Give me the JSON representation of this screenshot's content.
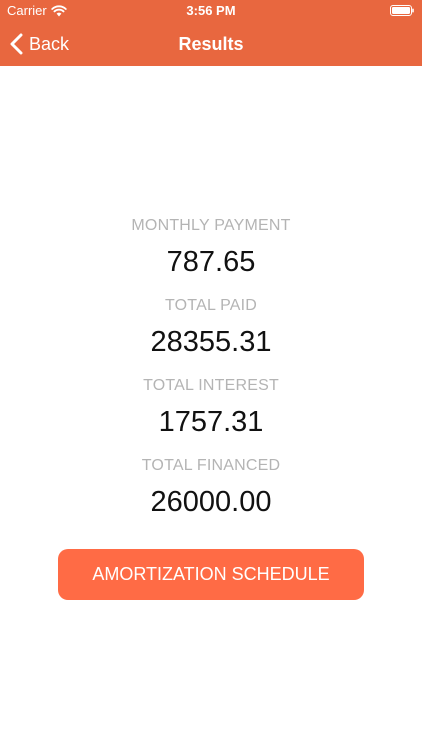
{
  "status_bar": {
    "carrier": "Carrier",
    "time": "3:56 PM"
  },
  "nav": {
    "back_label": "Back",
    "title": "Results"
  },
  "results": [
    {
      "label": "MONTHLY PAYMENT",
      "value": "787.65"
    },
    {
      "label": "TOTAL PAID",
      "value": "28355.31"
    },
    {
      "label": "TOTAL INTEREST",
      "value": "1757.31"
    },
    {
      "label": "TOTAL FINANCED",
      "value": "26000.00"
    }
  ],
  "button": {
    "label": "AMORTIZATION SCHEDULE"
  },
  "colors": {
    "header": "#E8673F",
    "button": "#FF6B45",
    "label_gray": "#B4B4B4"
  },
  "icons": [
    "wifi-icon",
    "battery-icon",
    "chevron-left-icon"
  ]
}
